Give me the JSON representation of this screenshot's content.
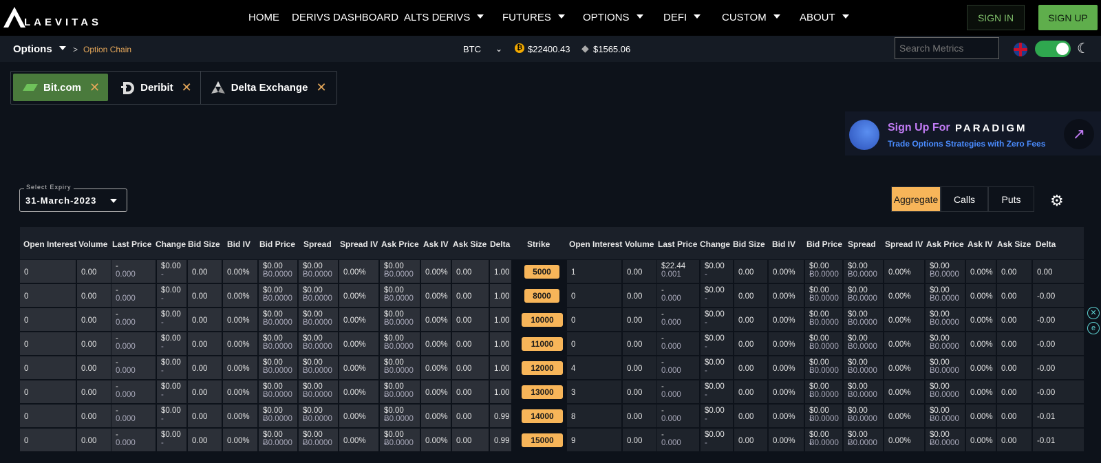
{
  "brand": {
    "name": "LAEVITAS"
  },
  "nav": {
    "items": [
      {
        "label": "HOME",
        "dropdown": false
      },
      {
        "label": "DERIVS DASHBOARD",
        "dropdown": false
      },
      {
        "label": "ALTS DERIVS",
        "dropdown": true
      },
      {
        "label": "FUTURES",
        "dropdown": true
      },
      {
        "label": "OPTIONS",
        "dropdown": true
      },
      {
        "label": "DEFI",
        "dropdown": true
      },
      {
        "label": "CUSTOM",
        "dropdown": true
      },
      {
        "label": "ABOUT",
        "dropdown": true
      }
    ],
    "sign_in": "SIGN IN",
    "sign_up": "SIGN UP"
  },
  "subbar": {
    "section": "Options",
    "separator": ">",
    "page": "Option Chain",
    "asset": "BTC",
    "btc_price": "$22400.43",
    "eth_price": "$1565.06",
    "search_placeholder": "Search Metrics"
  },
  "exchanges": [
    {
      "label": "Bit.com",
      "active": true
    },
    {
      "label": "Deribit",
      "active": false
    },
    {
      "label": "Delta Exchange",
      "active": false
    }
  ],
  "promo": {
    "title": "Sign Up For",
    "brand": "PARADIGM",
    "subtitle": "Trade Options Strategies with Zero Fees"
  },
  "expiry": {
    "label": "Select Expiry",
    "value": "31-March-2023"
  },
  "view_tabs": [
    {
      "label": "Aggregate",
      "active": true
    },
    {
      "label": "Calls",
      "active": false
    },
    {
      "label": "Puts",
      "active": false
    }
  ],
  "columns": {
    "calls": [
      "Open Interest",
      "Volume",
      "Last Price",
      "Change",
      "Bid Size",
      "Bid IV",
      "Bid Price",
      "Spread",
      "Spread IV",
      "Ask Price",
      "Ask IV",
      "Ask Size",
      "Delta"
    ],
    "strike": "Strike",
    "puts": [
      "Open Interest",
      "Volume",
      "Last Price",
      "Change",
      "Bid Size",
      "Bid IV",
      "Bid Price",
      "Spread",
      "Spread IV",
      "Ask Price",
      "Ask IV",
      "Ask Size",
      "Delta"
    ]
  },
  "rows": [
    {
      "strike": "5000",
      "calls": {
        "oi": "0",
        "vol": "0.00",
        "last": [
          "-",
          "0.000"
        ],
        "chg": [
          "$0.00",
          "-"
        ],
        "bidsize": "0.00",
        "biv": "0.00%",
        "bid": [
          "$0.00",
          "Ƀ0.0000"
        ],
        "spread": [
          "$0.00",
          "Ƀ0.0000"
        ],
        "siv": "0.00%",
        "ask": [
          "$0.00",
          "Ƀ0.0000"
        ],
        "aiv": "0.00%",
        "asksize": "0.00",
        "delta": "1.00"
      },
      "puts": {
        "oi": "1",
        "vol": "0.00",
        "last": [
          "$22.44",
          "0.001"
        ],
        "chg": [
          "$0.00",
          "-"
        ],
        "bidsize": "0.00",
        "biv": "0.00%",
        "bid": [
          "$0.00",
          "Ƀ0.0000"
        ],
        "spread": [
          "$0.00",
          "Ƀ0.0000"
        ],
        "siv": "0.00%",
        "ask": [
          "$0.00",
          "Ƀ0.0000"
        ],
        "aiv": "0.00%",
        "asksize": "0.00",
        "delta": "0.00"
      }
    },
    {
      "strike": "8000",
      "calls": {
        "oi": "0",
        "vol": "0.00",
        "last": [
          "-",
          "0.000"
        ],
        "chg": [
          "$0.00",
          "-"
        ],
        "bidsize": "0.00",
        "biv": "0.00%",
        "bid": [
          "$0.00",
          "Ƀ0.0000"
        ],
        "spread": [
          "$0.00",
          "Ƀ0.0000"
        ],
        "siv": "0.00%",
        "ask": [
          "$0.00",
          "Ƀ0.0000"
        ],
        "aiv": "0.00%",
        "asksize": "0.00",
        "delta": "1.00"
      },
      "puts": {
        "oi": "0",
        "vol": "0.00",
        "last": [
          "-",
          "0.000"
        ],
        "chg": [
          "$0.00",
          "-"
        ],
        "bidsize": "0.00",
        "biv": "0.00%",
        "bid": [
          "$0.00",
          "Ƀ0.0000"
        ],
        "spread": [
          "$0.00",
          "Ƀ0.0000"
        ],
        "siv": "0.00%",
        "ask": [
          "$0.00",
          "Ƀ0.0000"
        ],
        "aiv": "0.00%",
        "asksize": "0.00",
        "delta": "-0.00"
      }
    },
    {
      "strike": "10000",
      "calls": {
        "oi": "0",
        "vol": "0.00",
        "last": [
          "-",
          "0.000"
        ],
        "chg": [
          "$0.00",
          "-"
        ],
        "bidsize": "0.00",
        "biv": "0.00%",
        "bid": [
          "$0.00",
          "Ƀ0.0000"
        ],
        "spread": [
          "$0.00",
          "Ƀ0.0000"
        ],
        "siv": "0.00%",
        "ask": [
          "$0.00",
          "Ƀ0.0000"
        ],
        "aiv": "0.00%",
        "asksize": "0.00",
        "delta": "1.00"
      },
      "puts": {
        "oi": "0",
        "vol": "0.00",
        "last": [
          "-",
          "0.000"
        ],
        "chg": [
          "$0.00",
          "-"
        ],
        "bidsize": "0.00",
        "biv": "0.00%",
        "bid": [
          "$0.00",
          "Ƀ0.0000"
        ],
        "spread": [
          "$0.00",
          "Ƀ0.0000"
        ],
        "siv": "0.00%",
        "ask": [
          "$0.00",
          "Ƀ0.0000"
        ],
        "aiv": "0.00%",
        "asksize": "0.00",
        "delta": "-0.00"
      }
    },
    {
      "strike": "11000",
      "calls": {
        "oi": "0",
        "vol": "0.00",
        "last": [
          "-",
          "0.000"
        ],
        "chg": [
          "$0.00",
          "-"
        ],
        "bidsize": "0.00",
        "biv": "0.00%",
        "bid": [
          "$0.00",
          "Ƀ0.0000"
        ],
        "spread": [
          "$0.00",
          "Ƀ0.0000"
        ],
        "siv": "0.00%",
        "ask": [
          "$0.00",
          "Ƀ0.0000"
        ],
        "aiv": "0.00%",
        "asksize": "0.00",
        "delta": "1.00"
      },
      "puts": {
        "oi": "0",
        "vol": "0.00",
        "last": [
          "-",
          "0.000"
        ],
        "chg": [
          "$0.00",
          "-"
        ],
        "bidsize": "0.00",
        "biv": "0.00%",
        "bid": [
          "$0.00",
          "Ƀ0.0000"
        ],
        "spread": [
          "$0.00",
          "Ƀ0.0000"
        ],
        "siv": "0.00%",
        "ask": [
          "$0.00",
          "Ƀ0.0000"
        ],
        "aiv": "0.00%",
        "asksize": "0.00",
        "delta": "-0.00"
      }
    },
    {
      "strike": "12000",
      "calls": {
        "oi": "0",
        "vol": "0.00",
        "last": [
          "-",
          "0.000"
        ],
        "chg": [
          "$0.00",
          "-"
        ],
        "bidsize": "0.00",
        "biv": "0.00%",
        "bid": [
          "$0.00",
          "Ƀ0.0000"
        ],
        "spread": [
          "$0.00",
          "Ƀ0.0000"
        ],
        "siv": "0.00%",
        "ask": [
          "$0.00",
          "Ƀ0.0000"
        ],
        "aiv": "0.00%",
        "asksize": "0.00",
        "delta": "1.00"
      },
      "puts": {
        "oi": "4",
        "vol": "0.00",
        "last": [
          "-",
          "0.000"
        ],
        "chg": [
          "$0.00",
          "-"
        ],
        "bidsize": "0.00",
        "biv": "0.00%",
        "bid": [
          "$0.00",
          "Ƀ0.0000"
        ],
        "spread": [
          "$0.00",
          "Ƀ0.0000"
        ],
        "siv": "0.00%",
        "ask": [
          "$0.00",
          "Ƀ0.0000"
        ],
        "aiv": "0.00%",
        "asksize": "0.00",
        "delta": "-0.00"
      }
    },
    {
      "strike": "13000",
      "calls": {
        "oi": "0",
        "vol": "0.00",
        "last": [
          "-",
          "0.000"
        ],
        "chg": [
          "$0.00",
          "-"
        ],
        "bidsize": "0.00",
        "biv": "0.00%",
        "bid": [
          "$0.00",
          "Ƀ0.0000"
        ],
        "spread": [
          "$0.00",
          "Ƀ0.0000"
        ],
        "siv": "0.00%",
        "ask": [
          "$0.00",
          "Ƀ0.0000"
        ],
        "aiv": "0.00%",
        "asksize": "0.00",
        "delta": "1.00"
      },
      "puts": {
        "oi": "3",
        "vol": "0.00",
        "last": [
          "-",
          "0.000"
        ],
        "chg": [
          "$0.00",
          "-"
        ],
        "bidsize": "0.00",
        "biv": "0.00%",
        "bid": [
          "$0.00",
          "Ƀ0.0000"
        ],
        "spread": [
          "$0.00",
          "Ƀ0.0000"
        ],
        "siv": "0.00%",
        "ask": [
          "$0.00",
          "Ƀ0.0000"
        ],
        "aiv": "0.00%",
        "asksize": "0.00",
        "delta": "-0.00"
      }
    },
    {
      "strike": "14000",
      "calls": {
        "oi": "0",
        "vol": "0.00",
        "last": [
          "-",
          "0.000"
        ],
        "chg": [
          "$0.00",
          "-"
        ],
        "bidsize": "0.00",
        "biv": "0.00%",
        "bid": [
          "$0.00",
          "Ƀ0.0000"
        ],
        "spread": [
          "$0.00",
          "Ƀ0.0000"
        ],
        "siv": "0.00%",
        "ask": [
          "$0.00",
          "Ƀ0.0000"
        ],
        "aiv": "0.00%",
        "asksize": "0.00",
        "delta": "0.99"
      },
      "puts": {
        "oi": "8",
        "vol": "0.00",
        "last": [
          "-",
          "0.000"
        ],
        "chg": [
          "$0.00",
          "-"
        ],
        "bidsize": "0.00",
        "biv": "0.00%",
        "bid": [
          "$0.00",
          "Ƀ0.0000"
        ],
        "spread": [
          "$0.00",
          "Ƀ0.0000"
        ],
        "siv": "0.00%",
        "ask": [
          "$0.00",
          "Ƀ0.0000"
        ],
        "aiv": "0.00%",
        "asksize": "0.00",
        "delta": "-0.01"
      }
    },
    {
      "strike": "15000",
      "calls": {
        "oi": "0",
        "vol": "0.00",
        "last": [
          "-",
          "0.000"
        ],
        "chg": [
          "$0.00",
          "-"
        ],
        "bidsize": "0.00",
        "biv": "0.00%",
        "bid": [
          "$0.00",
          "Ƀ0.0000"
        ],
        "spread": [
          "$0.00",
          "Ƀ0.0000"
        ],
        "siv": "0.00%",
        "ask": [
          "$0.00",
          "Ƀ0.0000"
        ],
        "aiv": "0.00%",
        "asksize": "0.00",
        "delta": "0.99"
      },
      "puts": {
        "oi": "9",
        "vol": "0.00",
        "last": [
          "-",
          "0.000"
        ],
        "chg": [
          "$0.00",
          "-"
        ],
        "bidsize": "0.00",
        "biv": "0.00%",
        "bid": [
          "$0.00",
          "Ƀ0.0000"
        ],
        "spread": [
          "$0.00",
          "Ƀ0.0000"
        ],
        "siv": "0.00%",
        "ask": [
          "$0.00",
          "Ƀ0.0000"
        ],
        "aiv": "0.00%",
        "asksize": "0.00",
        "delta": "-0.01"
      }
    }
  ]
}
